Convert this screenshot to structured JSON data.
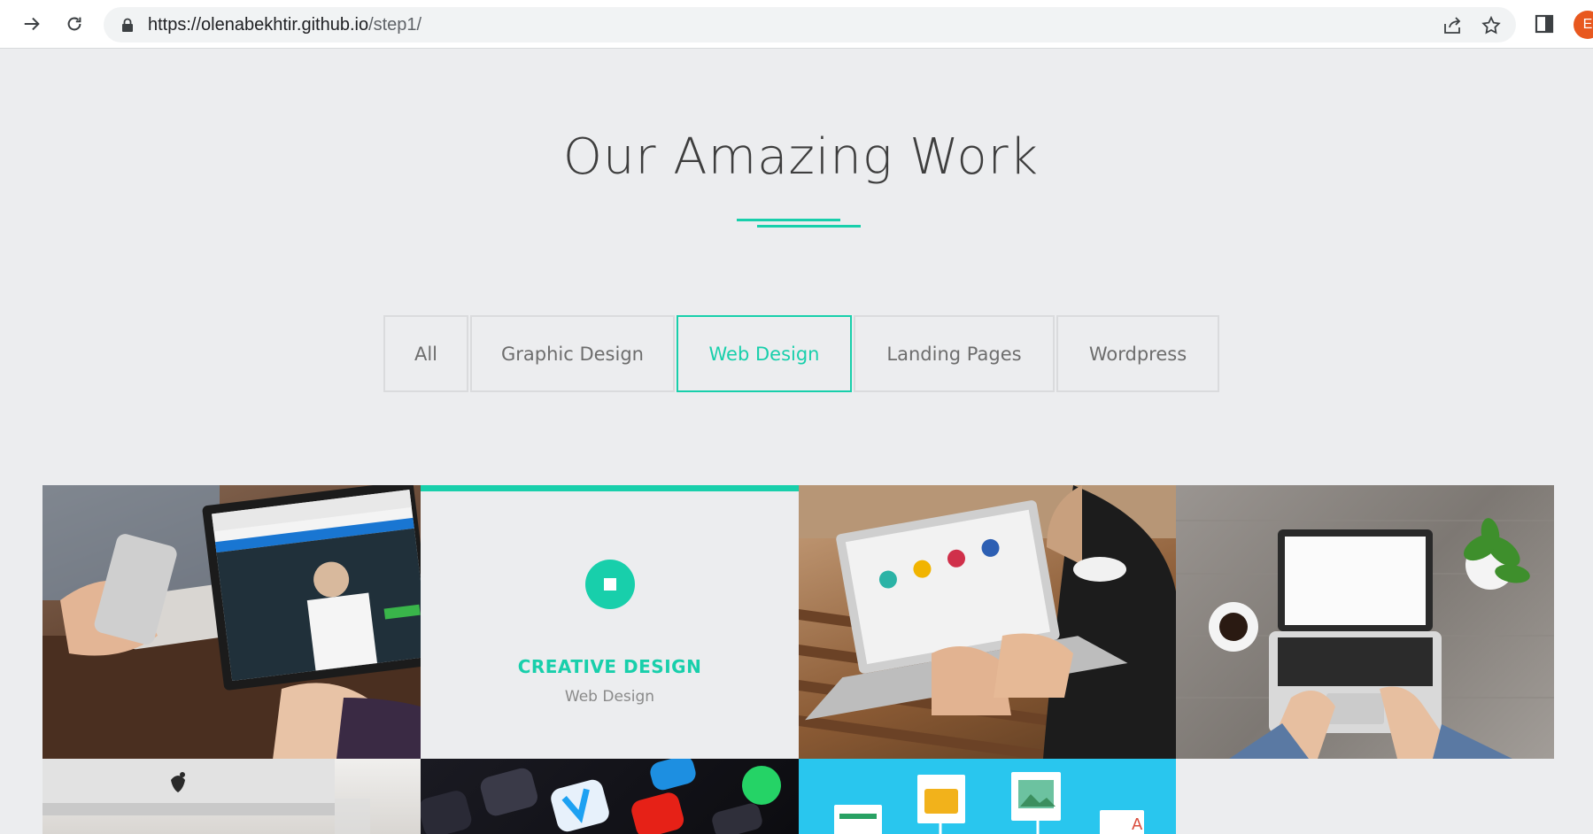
{
  "browser": {
    "url_host": "https://olenabekhtir.github.io",
    "url_path": "/step1/",
    "profile_initial": "E"
  },
  "section": {
    "title": "Our Amazing Work",
    "accent_color": "#18cfab"
  },
  "tabs": [
    {
      "label": "All",
      "active": false
    },
    {
      "label": "Graphic Design",
      "active": false
    },
    {
      "label": "Web Design",
      "active": true
    },
    {
      "label": "Landing Pages",
      "active": false
    },
    {
      "label": "Wordpress",
      "active": false
    }
  ],
  "gallery": {
    "hover_card": {
      "title": "CREATIVE DESIGN",
      "category": "Web Design"
    }
  }
}
